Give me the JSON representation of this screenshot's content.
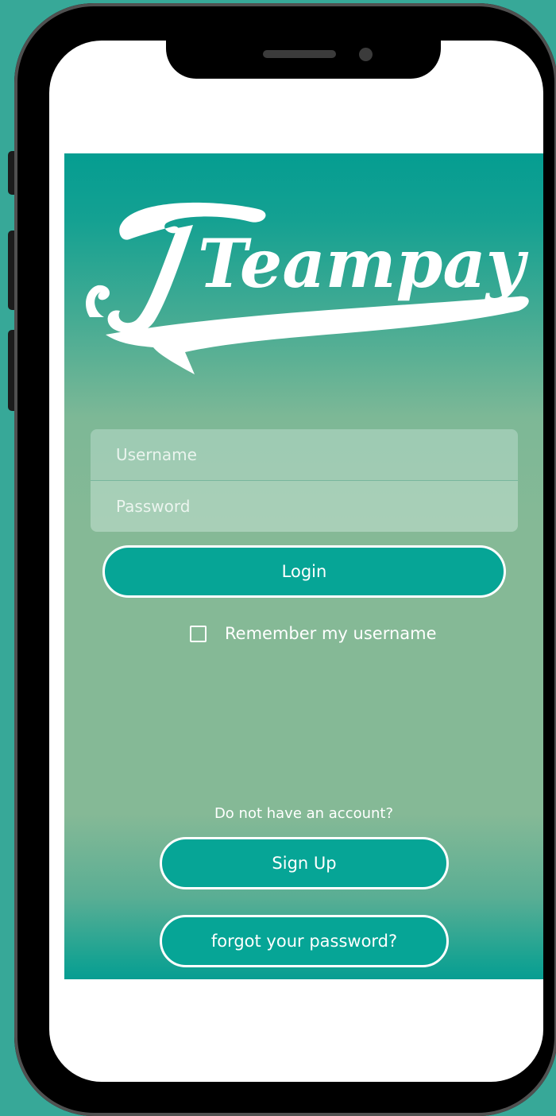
{
  "app": {
    "logo_text": "Teampay"
  },
  "login_form": {
    "username_placeholder": "Username",
    "password_placeholder": "Password",
    "login_label": "Login",
    "remember_label": "Remember my username",
    "remember_checked": false
  },
  "footer": {
    "no_account_text": "Do not have an account?",
    "signup_label": "Sign Up",
    "forgot_label": "forgot your password?"
  },
  "colors": {
    "accent": "#06a596",
    "page_background": "#37a898",
    "gradient_top": "#059d91",
    "gradient_middle": "#85b996"
  }
}
